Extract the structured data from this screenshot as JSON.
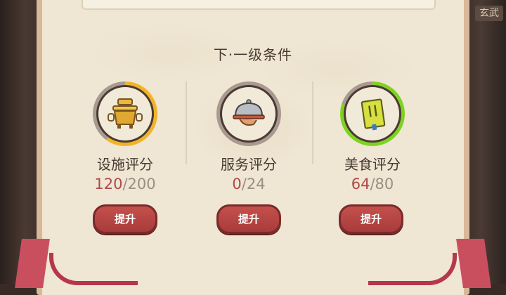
{
  "corner_tag": "玄武",
  "section_title": "下·一级条件",
  "stats": [
    {
      "label": "设施评分",
      "current": "120",
      "max": "/200",
      "progress": 0.6,
      "ring_color": "#f0b429",
      "icon": "pot-icon",
      "button": "提升"
    },
    {
      "label": "服务评分",
      "current": "0",
      "max": "/24",
      "progress": 0.0,
      "ring_color": "#f0b429",
      "icon": "cloche-icon",
      "button": "提升"
    },
    {
      "label": "美食评分",
      "current": "64",
      "max": "/80",
      "progress": 0.8,
      "ring_color": "#7ed321",
      "icon": "recipe-book-icon",
      "button": "提升"
    }
  ],
  "colors": {
    "ring_track": "#a89a90",
    "current_value": "#b04a4a",
    "button": "#b5453f"
  }
}
